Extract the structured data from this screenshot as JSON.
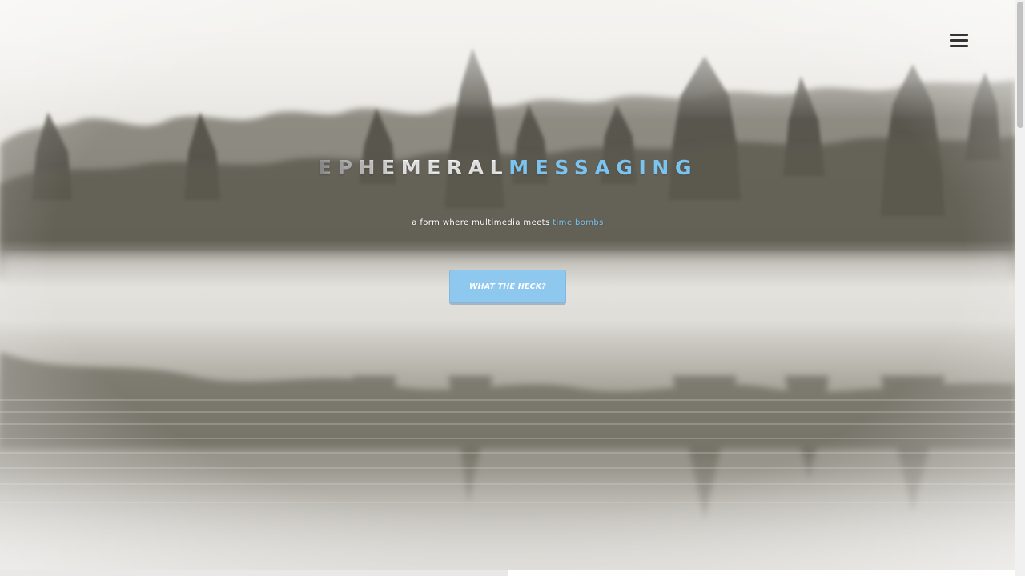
{
  "nav": {
    "menu_icon": "hamburger-menu-icon"
  },
  "hero": {
    "title_part1": "EPHEMERAL",
    "title_part2": "MESSAGING",
    "tagline_prefix": "a form where multimedia meets ",
    "tagline_highlight": "time bombs",
    "cta_label": "WHAT THE HECK?"
  },
  "colors": {
    "accent": "#7cc4f0",
    "button_bg": "#8ec8ef",
    "title_gradient_start": "#9a9a9a",
    "title_gradient_end": "#ffffff",
    "menu_icon": "#333333"
  },
  "background": {
    "description_icon": "misty-lake-forest-photo"
  }
}
